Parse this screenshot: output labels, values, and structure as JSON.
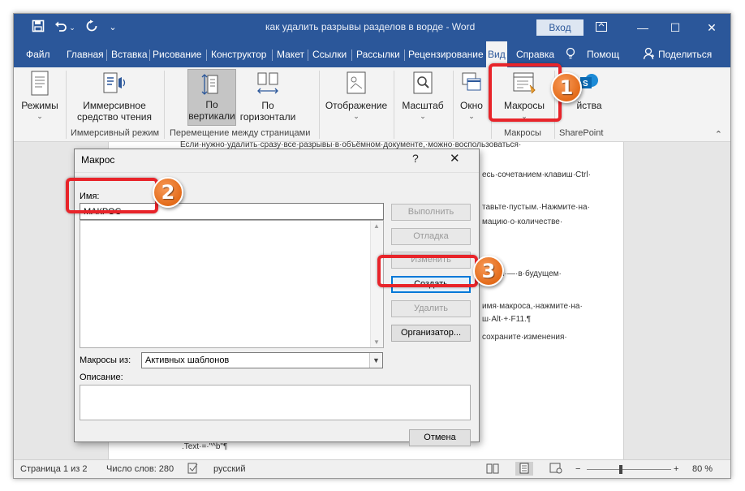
{
  "window": {
    "title": "как удалить разрывы разделов в ворде  -  Word",
    "login_label": "Вход",
    "icons": [
      "save-icon",
      "undo-icon",
      "redo-icon",
      "ribbon-display-icon",
      "minimize-icon",
      "maximize-icon",
      "close-icon"
    ]
  },
  "tabs": [
    {
      "label": "Файл"
    },
    {
      "label": "Главная"
    },
    {
      "label": "Вставка"
    },
    {
      "label": "Рисование"
    },
    {
      "label": "Конструктор"
    },
    {
      "label": "Макет"
    },
    {
      "label": "Ссылки"
    },
    {
      "label": "Рассылки"
    },
    {
      "label": "Рецензирование"
    },
    {
      "label": "Вид",
      "active": true
    },
    {
      "label": "Справка"
    }
  ],
  "tabs_right": {
    "help_search": "Помощ",
    "share": "Поделиться"
  },
  "ribbon": {
    "modes": "Режимы",
    "immersive_reader": [
      "Иммерсивное",
      "средство чтения"
    ],
    "vertical": [
      "По",
      "вертикали"
    ],
    "horizontal": [
      "По",
      "горизонтали"
    ],
    "display": "Отображение",
    "zoom": "Масштаб",
    "window": "Окно",
    "macros": "Макросы",
    "properties": "йства",
    "groups": {
      "immersive": "Иммерсивный режим",
      "page_movement": "Перемещение между страницами",
      "macros": "Макросы",
      "sharepoint": "SharePoint"
    }
  },
  "document": {
    "lines": [
      "Если·нужно·удалить·сразу·все·разрывы·в·объёмном·документе,·можно·воспользоваться·",
      "есь·сочетанием·клавиш·Ctrl·",
      "тавьте·пустым.·Нажмите·на·",
      "мацию·о·количестве·",
      "кросы·—·в·будущем·",
      "имя·макроса,·нажмите·на·",
      "ш·Alt·+·F11.¶",
      "сохраните·изменения·",
      ".Text·=·\"^b\"¶"
    ]
  },
  "dialog": {
    "title": "Макрос",
    "help": "?",
    "close": "✕",
    "name_label": "Имя:",
    "name_value": "МАКРОС",
    "buttons": {
      "run": "Выполнить",
      "step": "Отладка",
      "edit": "Изменить",
      "create": "Создать",
      "delete": "Удалить",
      "organizer": "Организатор...",
      "cancel": "Отмена"
    },
    "macros_from_label": "Макросы из:",
    "macros_from_value": "Активных шаблонов",
    "description_label": "Описание:"
  },
  "statusbar": {
    "page": "Страница 1 из 2",
    "words": "Число слов: 280",
    "language": "русский",
    "zoom": "80 %",
    "zoom_minus": "−",
    "zoom_plus": "+"
  },
  "annotations": {
    "badges": [
      "1",
      "2",
      "3"
    ],
    "color": "#e8242a",
    "badge_color": "#e36b1a"
  },
  "colors": {
    "word_blue": "#2b579a",
    "ribbon_bg": "#f3f3f3",
    "focus_blue": "#0078d7"
  }
}
